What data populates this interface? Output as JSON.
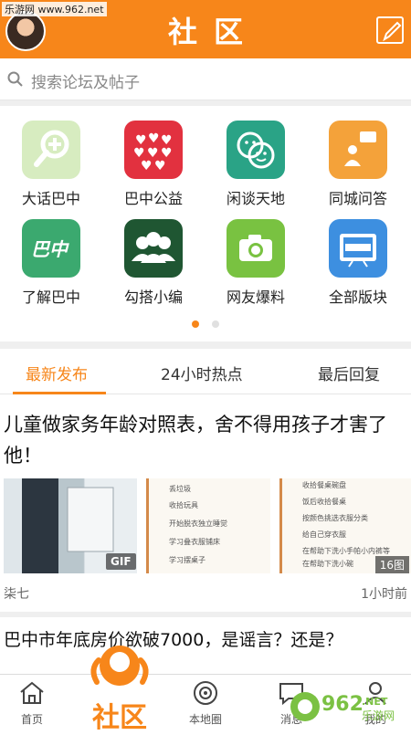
{
  "watermark": "乐游网 www.962.net",
  "header": {
    "title": "社区"
  },
  "search": {
    "placeholder": "搜索论坛及帖子"
  },
  "grid": {
    "items": [
      {
        "label": "大话巴中",
        "color": "#d7ecc0",
        "icon": "magnifier-plus-icon"
      },
      {
        "label": "巴中公益",
        "color": "#e2313f",
        "icon": "hearts-icon"
      },
      {
        "label": "闲谈天地",
        "color": "#2aa386",
        "icon": "chat-faces-icon"
      },
      {
        "label": "同城问答",
        "color": "#f4a23a",
        "icon": "qa-person-icon"
      },
      {
        "label": "了解巴中",
        "color": "#3ba96f",
        "icon": "bazhong-logo-icon"
      },
      {
        "label": "勾搭小编",
        "color": "#1f5632",
        "icon": "group-people-icon"
      },
      {
        "label": "网友爆料",
        "color": "#79c241",
        "icon": "camera-icon"
      },
      {
        "label": "全部版块",
        "color": "#3d8fe0",
        "icon": "breaking-news-icon"
      }
    ],
    "page_indicator": {
      "current": 1,
      "total": 2
    }
  },
  "tabs": [
    {
      "label": "最新发布",
      "active": true
    },
    {
      "label": "24小时热点",
      "active": false
    },
    {
      "label": "最后回复",
      "active": false
    }
  ],
  "post1": {
    "title": "儿童做家务年龄对照表，舍不得用孩子才害了他！",
    "gif_badge": "GIF",
    "image_count": "16图",
    "author": "柒七",
    "time": "1小时前",
    "list_a": [
      "丢垃圾",
      "收拾玩具",
      "开始脱衣独立睡觉",
      "学习叠衣服铺床",
      "学习摆桌子"
    ],
    "list_b": [
      "收拾餐桌碗盘",
      "饭后收拾餐桌",
      "按颜色挑选衣服分类",
      "给自己穿衣服",
      "在帮助下洗小手帕小内裤等",
      "在帮助下洗小碗"
    ]
  },
  "post2": {
    "title": "巴中市年底房价欲破7000，是谣言？还是？"
  },
  "bottom_nav": {
    "home": "首页",
    "community": "社区",
    "local_map": "本地圈",
    "messages": "消息",
    "mine": "我的"
  },
  "site_mark": {
    "number": "962",
    "suffix": ".NET",
    "name": "乐游网"
  },
  "colors": {
    "accent": "#f7861a"
  }
}
